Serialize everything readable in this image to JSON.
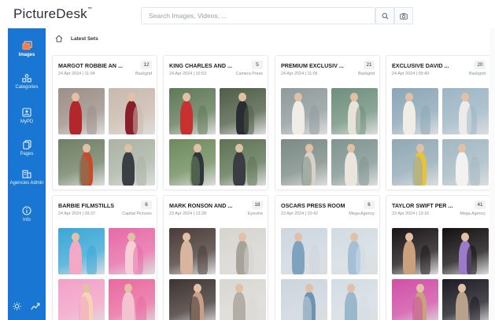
{
  "app": {
    "logo": "PictureDesk",
    "logo_mark": "™"
  },
  "search": {
    "placeholder": "Search Images, Videos, ..."
  },
  "sidebar": {
    "items": [
      {
        "key": "images",
        "label": "Images",
        "icon": "images-icon",
        "active": true
      },
      {
        "key": "categories",
        "label": "Categories",
        "icon": "categories-icon",
        "active": false
      },
      {
        "key": "mypd",
        "label": "MyPD",
        "icon": "mypd-icon",
        "active": false
      },
      {
        "key": "pages",
        "label": "Pages",
        "icon": "pages-icon",
        "active": false
      },
      {
        "key": "agencies",
        "label": "Agencies Admin",
        "icon": "agencies-icon",
        "active": false
      },
      {
        "key": "info",
        "label": "Info",
        "icon": "info-icon",
        "active": false
      }
    ],
    "bottom": [
      "theme-icon",
      "analytics-icon"
    ]
  },
  "breadcrumb": {
    "label": "Latest Sets"
  },
  "cards": [
    {
      "title": "MARGOT ROBBIE AN ...",
      "count": "12",
      "date": "24 Apr 2024 | 11:04",
      "agency": "Backgrid",
      "thumbs": [
        [
          "#9c8f87",
          "#b3262c"
        ],
        [
          "#c9b9ad",
          "#8a1f2b"
        ],
        [
          "#6f7f64",
          "#c74b2a"
        ],
        [
          "#aab3a4",
          "#3a3f44"
        ]
      ]
    },
    {
      "title": "KING CHARLES AND ...",
      "count": "5",
      "date": "24 Apr 2024 | 10:53",
      "agency": "Camera Press",
      "thumbs": [
        [
          "#5f7a57",
          "#c7312f"
        ],
        [
          "#4f5e46",
          "#2a2d33"
        ],
        [
          "#6d8a5c",
          "#30343c"
        ],
        [
          "#5c7352",
          "#3b3d45"
        ]
      ]
    },
    {
      "title": "PREMIUM EXCLUSIV ...",
      "count": "21",
      "date": "24 Apr 2024 | 11:05",
      "agency": "Backgrid",
      "thumbs": [
        [
          "#8f9a9b",
          "#f0ede6"
        ],
        [
          "#6f8f7d",
          "#e8e3da"
        ],
        [
          "#7a8a84",
          "#d7d2c8"
        ],
        [
          "#7f9490",
          "#eae6dd"
        ]
      ]
    },
    {
      "title": "EXCLUSIVE DAVID ...",
      "count": "20",
      "date": "24 Apr 2024 | 09:49",
      "agency": "Backgrid",
      "thumbs": [
        [
          "#8ba6b7",
          "#f0ede6"
        ],
        [
          "#9cb5c4",
          "#ecebea"
        ],
        [
          "#90a9b5",
          "#e7c23d"
        ],
        [
          "#a3b8c2",
          "#f2f2f0"
        ]
      ]
    },
    {
      "title": "BARBIE FILMSTILLS",
      "count": "6",
      "date": "24 Apr 2024 | 09:37",
      "agency": "Capital Pictures",
      "thumbs": [
        [
          "#3aa7d6",
          "#f3a9c4"
        ],
        [
          "#e76aa7",
          "#f6cfd9"
        ],
        [
          "#f2a1c6",
          "#f7d3b5"
        ],
        [
          "#e9699f",
          "#f3c3d0"
        ]
      ]
    },
    {
      "title": "MARK RONSON AND ...",
      "count": "18",
      "date": "23 Apr 2024 | 13:28",
      "agency": "Eyevine",
      "thumbs": [
        [
          "#4a3c38",
          "#d9b5a0"
        ],
        [
          "#d6d4cf",
          "#a7a39b"
        ],
        [
          "#3e3431",
          "#c8a08a"
        ],
        [
          "#d9d7d2",
          "#b3afa7"
        ]
      ]
    },
    {
      "title": "OSCARS PRESS ROOM",
      "count": "6",
      "date": "23 Apr 2024 | 10:42",
      "agency": "Mega Agency",
      "thumbs": [
        [
          "#cdd6de",
          "#7fa2bf"
        ],
        [
          "#d2dbe2",
          "#a4c0d6"
        ],
        [
          "#cbd5dc",
          "#6f94b2"
        ],
        [
          "#d3dce3",
          "#9bb7cc"
        ]
      ]
    },
    {
      "title": "TAYLOR SWIFT PER ...",
      "count": "41",
      "date": "23 Apr 2024 | 13:16",
      "agency": "Mega Agency",
      "thumbs": [
        [
          "#1a1416",
          "#caa07d"
        ],
        [
          "#141012",
          "#9c7cc9"
        ],
        [
          "#d04fa6",
          "#c8a27c"
        ],
        [
          "#1c1a22",
          "#b9a28c"
        ]
      ]
    }
  ]
}
